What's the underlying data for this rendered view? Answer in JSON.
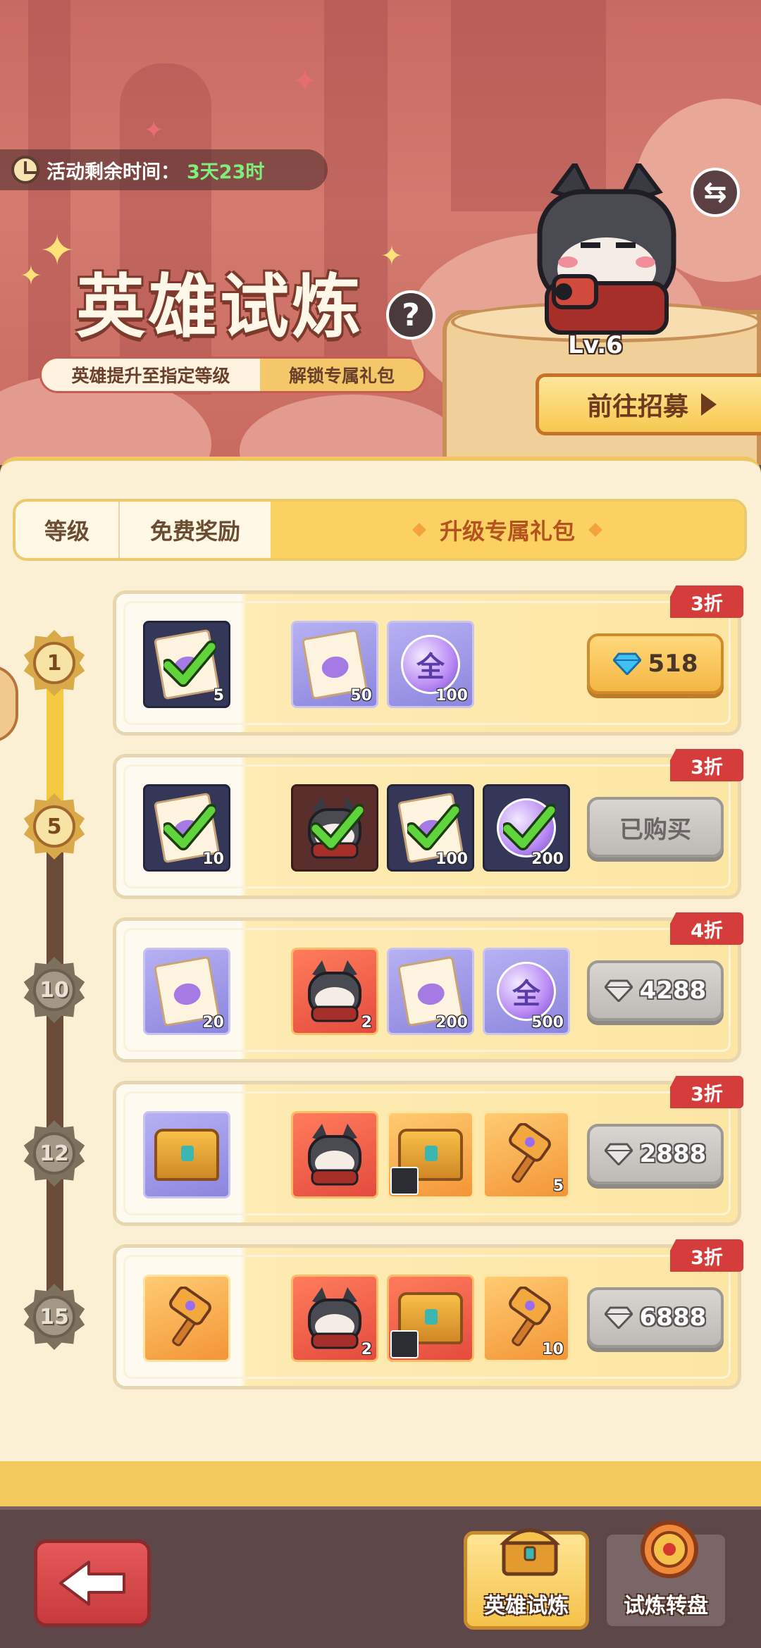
{
  "header": {
    "timer_label": "活动剩余时间：",
    "timer_value": "3天23时",
    "title": "英雄试炼",
    "help_label": "?",
    "subtitle_left": "英雄提升至指定等级",
    "subtitle_right": "解锁专属礼包",
    "hero_level": "Lv.6",
    "recruit_label": "前往招募",
    "swap_icon": "⇆"
  },
  "tabs": {
    "level": "等级",
    "free_rewards": "免费奖励",
    "upgrade_pack": "升级专属礼包"
  },
  "rows": [
    {
      "level": "1",
      "reached": true,
      "discount": "3折",
      "free": {
        "icon": "integral-scroll-icon",
        "qty": "5",
        "owned": true
      },
      "items": [
        {
          "icon": "integral-scroll-icon",
          "qty": "50",
          "owned": false,
          "style": "purple"
        },
        {
          "icon": "all-orb-icon",
          "glyph": "全",
          "qty": "100",
          "owned": false,
          "style": "purple"
        }
      ],
      "price": "518",
      "price_state": "available"
    },
    {
      "level": "5",
      "reached": true,
      "discount": "3折",
      "free": {
        "icon": "integral-scroll-icon",
        "qty": "10",
        "owned": true
      },
      "items": [
        {
          "icon": "hero-shard-icon",
          "qty": "",
          "owned": true,
          "style": "ownedred"
        },
        {
          "icon": "integral-scroll-icon",
          "qty": "100",
          "owned": true,
          "style": "owned"
        },
        {
          "icon": "all-orb-icon",
          "qty": "200",
          "owned": true,
          "style": "owned"
        }
      ],
      "price": "已购买",
      "price_state": "bought"
    },
    {
      "level": "10",
      "reached": false,
      "discount": "4折",
      "free": {
        "icon": "integral-scroll-icon",
        "qty": "20",
        "owned": false
      },
      "items": [
        {
          "icon": "hero-shard-icon",
          "qty": "2",
          "owned": false,
          "style": "red"
        },
        {
          "icon": "integral-scroll-icon",
          "qty": "200",
          "owned": false,
          "style": "purple"
        },
        {
          "icon": "all-orb-icon",
          "glyph": "全",
          "qty": "500",
          "owned": false,
          "style": "purple"
        }
      ],
      "price": "4288",
      "price_state": "locked"
    },
    {
      "level": "12",
      "reached": false,
      "discount": "3折",
      "free": {
        "icon": "treasure-chest-icon",
        "qty": "",
        "owned": false
      },
      "items": [
        {
          "icon": "hero-shard-icon",
          "qty": "",
          "owned": false,
          "style": "red"
        },
        {
          "icon": "mystery-chest-icon",
          "qty": "",
          "owned": false,
          "style": "orange"
        },
        {
          "icon": "hammer-icon",
          "qty": "5",
          "owned": false,
          "style": "orange"
        }
      ],
      "price": "2888",
      "price_state": "locked"
    },
    {
      "level": "15",
      "reached": false,
      "discount": "3折",
      "free": {
        "icon": "hammer-icon",
        "qty": "",
        "owned": false
      },
      "items": [
        {
          "icon": "hero-shard-icon",
          "qty": "2",
          "owned": false,
          "style": "red"
        },
        {
          "icon": "crown-chest-icon",
          "qty": "",
          "owned": false,
          "style": "red"
        },
        {
          "icon": "hammer-icon",
          "qty": "10",
          "owned": false,
          "style": "orange"
        }
      ],
      "price": "6888",
      "price_state": "locked"
    }
  ],
  "bottom_nav": {
    "back_icon": "back-arrow-icon",
    "tab_active": "英雄试炼",
    "tab_inactive": "试炼转盘"
  },
  "colors": {
    "header_bg": "#c86a63",
    "panel_bg": "#fbf0d3",
    "accent_gold": "#f4c940",
    "discount_red": "#d43d3c",
    "timer_green": "#7ef07a"
  }
}
